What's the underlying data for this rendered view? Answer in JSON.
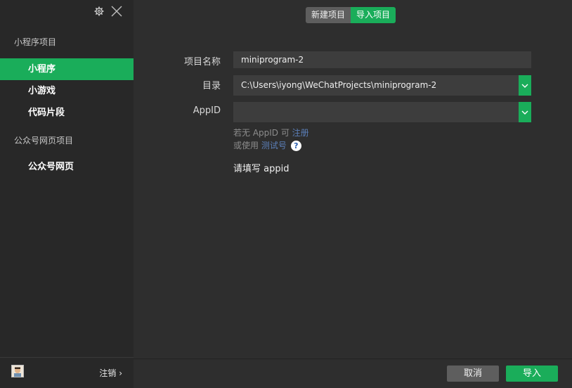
{
  "sidebar": {
    "section_miniprogram": "小程序项目",
    "items": [
      {
        "label": "小程序"
      },
      {
        "label": "小游戏"
      },
      {
        "label": "代码片段"
      }
    ],
    "section_official": "公众号网页项目",
    "official_items": [
      {
        "label": "公众号网页"
      }
    ],
    "logout_label": "注销 ›"
  },
  "tabs": {
    "new_project": "新建项目",
    "import_project": "导入项目"
  },
  "form": {
    "name_label": "项目名称",
    "name_value": "miniprogram-2",
    "dir_label": "目录",
    "dir_value": "C:\\Users\\iyong\\WeChatProjects\\miniprogram-2",
    "appid_label": "AppID",
    "appid_value": "",
    "hint1_prefix": "若无 AppID 可 ",
    "hint1_link": "注册",
    "hint2_prefix": "或使用 ",
    "hint2_link": "测试号",
    "help_glyph": "?",
    "error_text": "请填写 appid"
  },
  "footer": {
    "cancel_label": "取消",
    "import_label": "导入"
  },
  "colors": {
    "accent": "#1aad5a",
    "link": "#5b7fb8"
  }
}
